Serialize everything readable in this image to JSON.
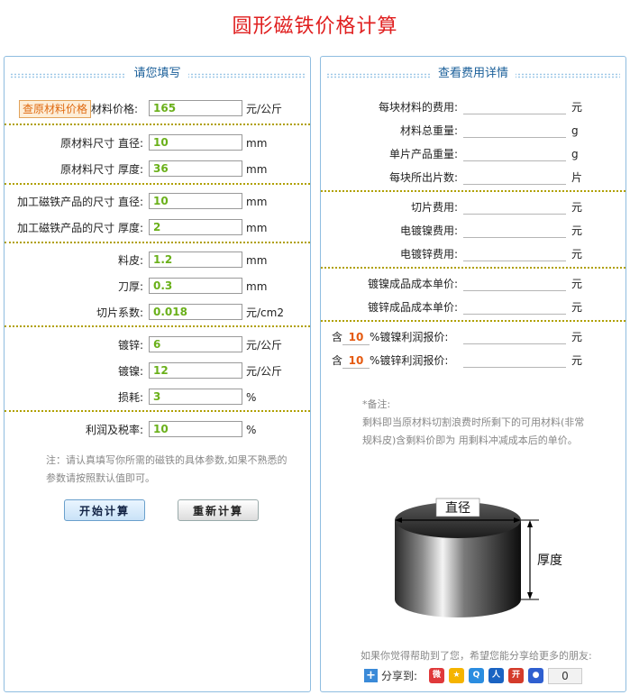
{
  "title": "圆形磁铁价格计算",
  "left": {
    "header": "请您填写",
    "lookup_button": "查原材料价格",
    "material_price": {
      "label": "材料价格:",
      "value": "165",
      "unit": "元/公斤"
    },
    "raw_diameter": {
      "label": "原材料尺寸 直径:",
      "value": "10",
      "unit": "mm"
    },
    "raw_thickness": {
      "label": "原材料尺寸 厚度:",
      "value": "36",
      "unit": "mm"
    },
    "prod_diameter": {
      "label": "加工磁铁产品的尺寸 直径:",
      "value": "10",
      "unit": "mm"
    },
    "prod_thickness": {
      "label": "加工磁铁产品的尺寸 厚度:",
      "value": "2",
      "unit": "mm"
    },
    "scrap": {
      "label": "料皮:",
      "value": "1.2",
      "unit": "mm"
    },
    "blade": {
      "label": "刀厚:",
      "value": "0.3",
      "unit": "mm"
    },
    "slice_coef": {
      "label": "切片系数:",
      "value": "0.018",
      "unit": "元/cm2"
    },
    "zinc": {
      "label": "镀锌:",
      "value": "6",
      "unit": "元/公斤"
    },
    "nickel": {
      "label": "镀镍:",
      "value": "12",
      "unit": "元/公斤"
    },
    "loss": {
      "label": "损耗:",
      "value": "3",
      "unit": "%"
    },
    "profit": {
      "label": "利润及税率:",
      "value": "10",
      "unit": "%"
    },
    "note": "注：请认真填写你所需的磁铁的具体参数,如果不熟悉的参数请按照默认值即可。",
    "start_button": "开始计算",
    "reset_button": "重新计算"
  },
  "right": {
    "header": "查看费用详情",
    "rows1": [
      {
        "label": "每块材料的费用:",
        "unit": "元"
      },
      {
        "label": "材料总重量:",
        "unit": "g"
      },
      {
        "label": "单片产品重量:",
        "unit": "g"
      },
      {
        "label": "每块所出片数:",
        "unit": "片"
      }
    ],
    "rows2": [
      {
        "label": "切片费用:",
        "unit": "元"
      },
      {
        "label": "电镀镍费用:",
        "unit": "元"
      },
      {
        "label": "电镀锌费用:",
        "unit": "元"
      }
    ],
    "rows3": [
      {
        "label": "镀镍成品成本单价:",
        "unit": "元"
      },
      {
        "label": "镀锌成品成本单价:",
        "unit": "元"
      }
    ],
    "profit_rows": [
      {
        "prefix": "含",
        "pct": "10",
        "suffix": "%镀镍利润报价:",
        "unit": "元"
      },
      {
        "prefix": "含",
        "pct": "10",
        "suffix": "%镀锌利润报价:",
        "unit": "元"
      }
    ],
    "remark_title": "*备注:",
    "remark_text": "剩料即当原材料切割浪费时所剩下的可用材料(非常规料皮)含剩料价即为 用剩料冲减成本后的单价。",
    "diagram": {
      "diameter_label": "直径",
      "thickness_label": "厚度"
    },
    "share_prompt": "如果你觉得帮助到了您，希望您能分享给更多的朋友:",
    "share_label": "分享到:",
    "share_count": "0",
    "share_icons": [
      "sina-weibo-icon",
      "qzone-icon",
      "qq-icon",
      "renren-icon",
      "kaixin-icon",
      "baidu-icon"
    ]
  },
  "colors": {
    "title": "#e02020",
    "panel_border": "#8fbde0",
    "header_text": "#1a5f99",
    "field_value": "#6ab01a",
    "separator": "#b0a000",
    "pct_value": "#e55a10"
  }
}
